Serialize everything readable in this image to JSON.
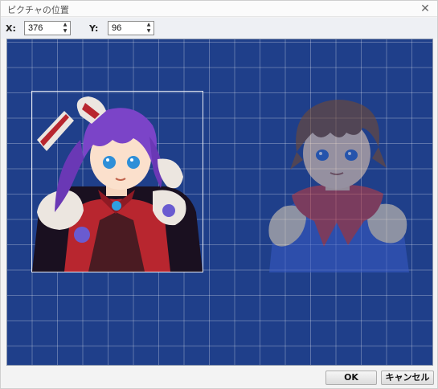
{
  "window": {
    "title": "ピクチャの位置",
    "close_glyph": "✕"
  },
  "position": {
    "x_label": "X:",
    "x_value": "376",
    "y_label": "Y:",
    "y_value": "96",
    "spin_up": "▲",
    "spin_down": "▼"
  },
  "canvas": {
    "background_color": "#1f3f8a",
    "grid": true,
    "pictures": [
      {
        "name": "selected-picture",
        "subject": "purple-haired girl in red armor",
        "selected": true
      },
      {
        "name": "reference-picture",
        "subject": "brown-haired boy in blue armor",
        "selected": false,
        "translucent": true
      }
    ]
  },
  "footer": {
    "ok_label": "OK",
    "cancel_label": "キャンセル"
  }
}
